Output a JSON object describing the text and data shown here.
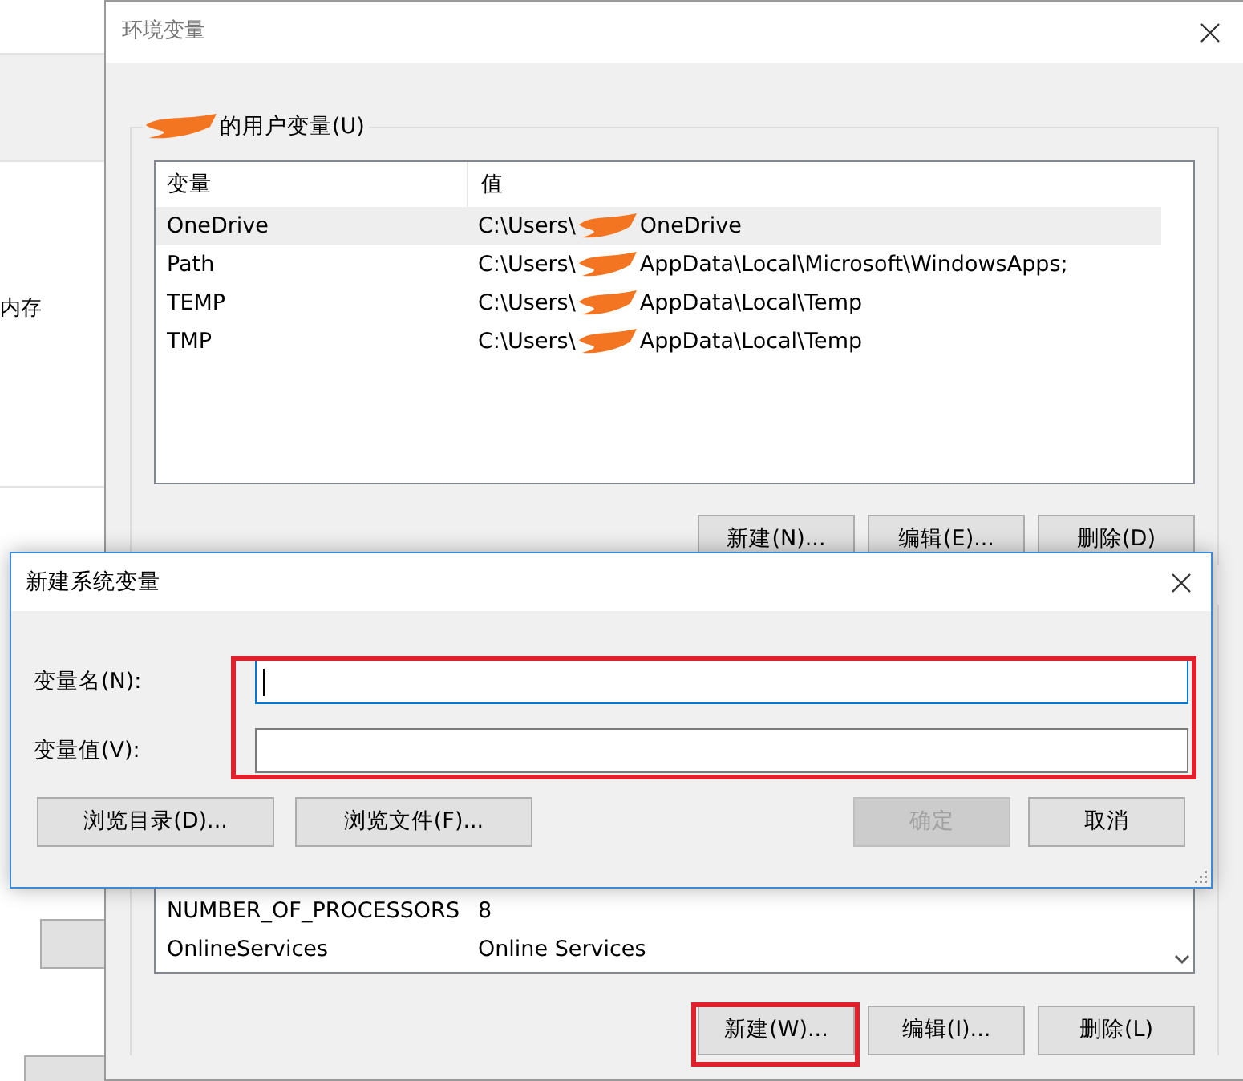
{
  "background_window": {
    "label": "内存"
  },
  "env_window": {
    "title": "环境变量",
    "user_group": {
      "label": "的用户变量(U)",
      "columns": [
        "变量",
        "值"
      ],
      "rows": [
        {
          "name": "OneDrive",
          "value_prefix": "C:\\Users\\",
          "value_suffix": "OneDrive",
          "selected": true
        },
        {
          "name": "Path",
          "value_prefix": "C:\\Users\\",
          "value_suffix": "AppData\\Local\\Microsoft\\WindowsApps;",
          "selected": false
        },
        {
          "name": "TEMP",
          "value_prefix": "C:\\Users\\",
          "value_suffix": "AppData\\Local\\Temp",
          "selected": false
        },
        {
          "name": "TMP",
          "value_prefix": "C:\\Users\\",
          "value_suffix": "AppData\\Local\\Temp",
          "selected": false
        }
      ],
      "buttons": [
        {
          "label": "新建(N)...",
          "highlighted": false
        },
        {
          "label": "编辑(E)...",
          "highlighted": false
        },
        {
          "label": "删除(D)",
          "highlighted": false
        }
      ]
    },
    "system_group": {
      "rows": [
        {
          "name": "NUMBER_OF_PROCESSORS",
          "value": "8",
          "selected": false
        },
        {
          "name": "OnlineServices",
          "value": "Online Services",
          "selected": false
        }
      ],
      "buttons": [
        {
          "label": "新建(W)...",
          "highlighted": true
        },
        {
          "label": "编辑(I)...",
          "highlighted": false
        },
        {
          "label": "删除(L)",
          "highlighted": false
        }
      ]
    }
  },
  "dialog": {
    "title": "新建系统变量",
    "fields_highlighted": true,
    "fields": [
      {
        "label": "变量名(N):",
        "focused": true
      },
      {
        "label": "变量值(V):",
        "focused": false
      }
    ],
    "left_buttons": [
      {
        "label": "浏览目录(D)...",
        "disabled": false
      },
      {
        "label": "浏览文件(F)...",
        "disabled": false
      }
    ],
    "right_buttons": [
      {
        "label": "确定",
        "disabled": true
      },
      {
        "label": "取消",
        "disabled": false
      }
    ]
  }
}
